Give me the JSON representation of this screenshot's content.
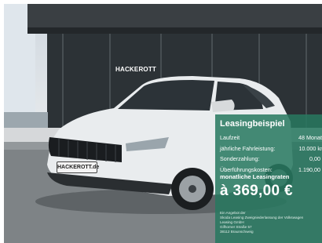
{
  "listing": {
    "dealer_sign": "HACKEROTT",
    "plate_text": "HACKEROTT.de"
  },
  "leasing": {
    "title": "Leasingbeispiel",
    "rows": [
      {
        "label": "Laufzeit",
        "value": "48 Monate"
      },
      {
        "label": "jährliche Fahrleistung:",
        "value": "10.000 km"
      },
      {
        "label": "Sonderzahlung:",
        "value": "0,00 €"
      },
      {
        "label": "Überführungskosten:",
        "value": "1.190,00 €"
      }
    ],
    "rate_label": "monatliche Leasingraten",
    "rate_value": "à 369,00 €",
    "fine_print": [
      "Ein Angebot der",
      "Skoda Leasing Zweigniederlassung der Volkswagen",
      "Leasing GmbH",
      "Gifhorner Straße 57",
      "38112 Braunschweig"
    ]
  },
  "colors": {
    "panel": "#28785f",
    "car_body": "#e9ecee",
    "showroom": "#2a2f33"
  }
}
